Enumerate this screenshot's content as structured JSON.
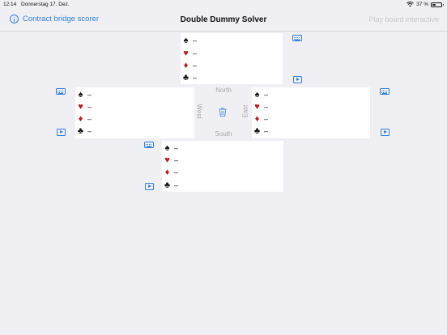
{
  "status": {
    "time": "12:14",
    "date": "Donnerstag 17. Dez.",
    "battery": "37 %",
    "battery_level": 0.37
  },
  "nav": {
    "back_label": "Contract bridge scorer",
    "title": "Double Dummy Solver",
    "action_label": "Play board interactive"
  },
  "compass": {
    "north": "North",
    "south": "South",
    "west": "West",
    "east": "East"
  },
  "hands": {
    "north": {
      "spades": "–",
      "hearts": "–",
      "diamonds": "–",
      "clubs": "–"
    },
    "west": {
      "spades": "–",
      "hearts": "–",
      "diamonds": "–",
      "clubs": "–"
    },
    "east": {
      "spades": "–",
      "hearts": "–",
      "diamonds": "–",
      "clubs": "–"
    },
    "south": {
      "spades": "–",
      "hearts": "–",
      "diamonds": "–",
      "clubs": "–"
    }
  },
  "suits": {
    "spades": "♠",
    "hearts": "♥",
    "diamonds": "♦",
    "clubs": "♣"
  },
  "colors": {
    "accent": "#2f7fe0",
    "red_suit": "#c4161c",
    "background": "#efeff4"
  }
}
